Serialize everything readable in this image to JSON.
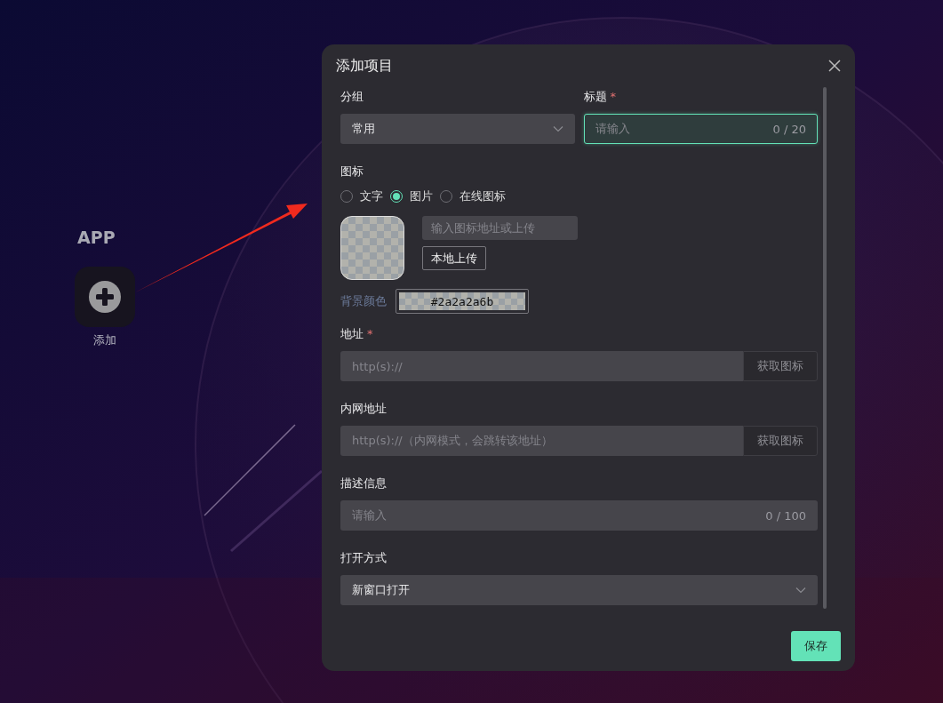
{
  "desktop": {
    "section_title": "APP",
    "apps": [
      {
        "label": "添加"
      }
    ]
  },
  "dialog": {
    "title": "添加项目",
    "group": {
      "label": "分组",
      "value": "常用"
    },
    "title_field": {
      "label": "标题",
      "required_mark": "*",
      "placeholder": "请输入",
      "counter": "0 / 20",
      "focused": true
    },
    "icon": {
      "label": "图标",
      "options": [
        {
          "label": "文字",
          "selected": false
        },
        {
          "label": "图片",
          "selected": true
        },
        {
          "label": "在线图标",
          "selected": false
        }
      ],
      "url_placeholder": "输入图标地址或上传",
      "upload_button": "本地上传",
      "bg_color_label": "背景颜色",
      "bg_color_value": "#2a2a2a6b"
    },
    "address": {
      "label": "地址",
      "required_mark": "*",
      "placeholder": "http(s)://",
      "addon": "获取图标"
    },
    "intranet_address": {
      "label": "内网地址",
      "placeholder": "http(s)://（内网模式，会跳转该地址）",
      "addon": "获取图标"
    },
    "description": {
      "label": "描述信息",
      "placeholder": "请输入",
      "counter": "0 / 100"
    },
    "open_mode": {
      "label": "打开方式",
      "value": "新窗口打开"
    },
    "save_button": "保存"
  }
}
